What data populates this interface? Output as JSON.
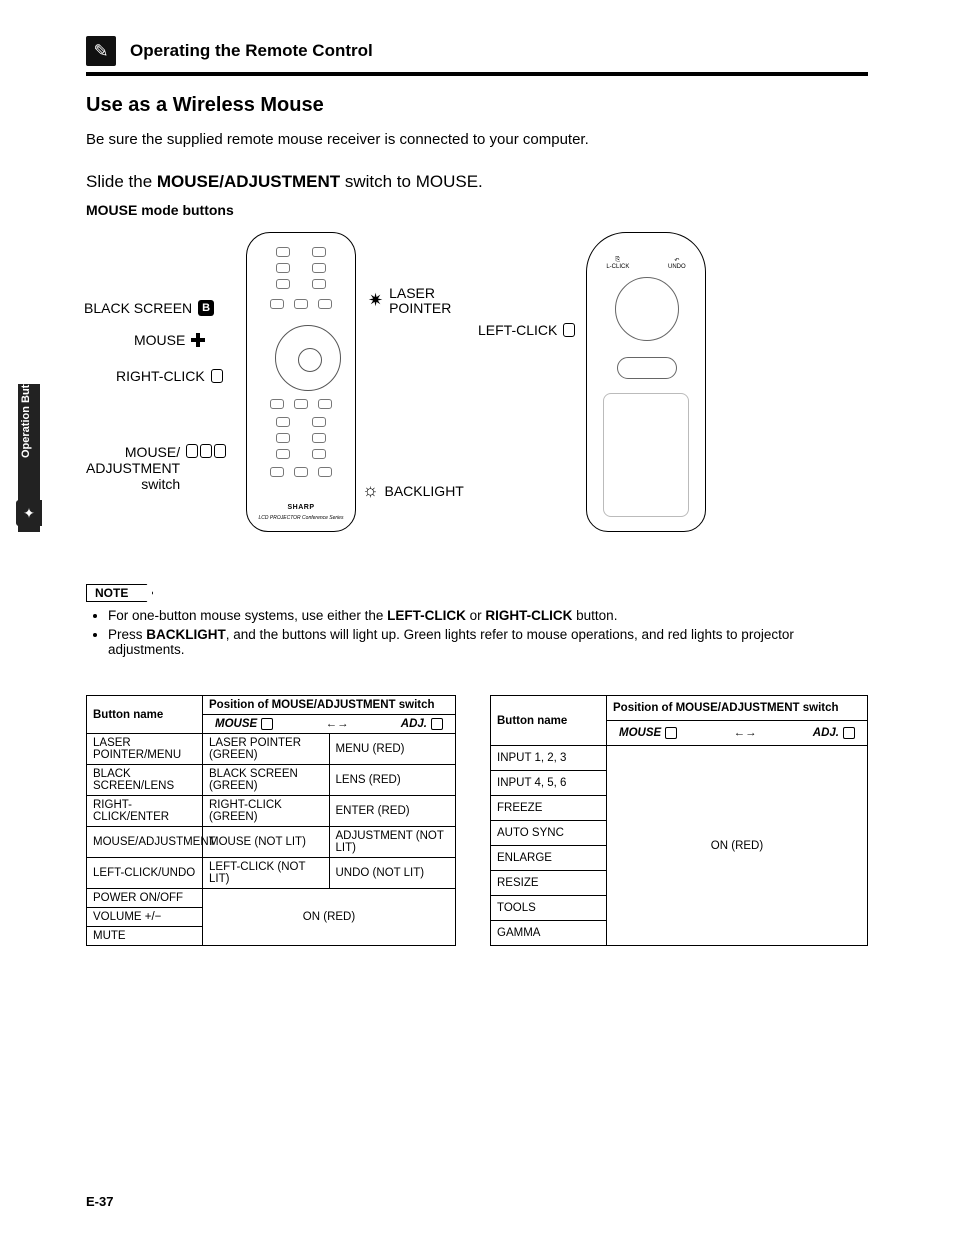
{
  "header": {
    "title": "Operating the Remote Control",
    "sidetab": "Operation Buttons"
  },
  "section": {
    "heading": "Use as a Wireless Mouse",
    "intro": "Be sure the supplied remote mouse receiver is connected to your computer.",
    "slide_pre": "Slide the ",
    "slide_bold": "MOUSE/ADJUSTMENT",
    "slide_post": " switch to MOUSE.",
    "modebtns": "MOUSE mode buttons"
  },
  "callouts": {
    "black_screen": "BLACK SCREEN",
    "mouse": "MOUSE",
    "right_click": "RIGHT-CLICK",
    "mouse_adj_switch_l1": "MOUSE/",
    "mouse_adj_switch_l2": "ADJUSTMENT",
    "mouse_adj_switch_l3": "switch",
    "laser_l1": "LASER",
    "laser_l2": "POINTER",
    "backlight": "BACKLIGHT",
    "left_click": "LEFT-CLICK"
  },
  "remote": {
    "brand": "SHARP",
    "sub": "LCD PROJECTOR  Conference Series",
    "side_lclick": "L-CLICK",
    "side_undo": "UNDO"
  },
  "note": {
    "label": "NOTE",
    "items": [
      {
        "pre": "For one-button mouse systems, use either the ",
        "b1": "LEFT-CLICK",
        "mid": " or ",
        "b2": "RIGHT-CLICK",
        "post": " button."
      },
      {
        "pre": "Press ",
        "b1": "BACKLIGHT",
        "post": ", and the buttons will light up. Green lights refer to mouse operations, and red lights to projector adjustments."
      }
    ]
  },
  "table_common": {
    "col_button": "Button name",
    "col_position": "Position of MOUSE/ADJUSTMENT switch",
    "mode_mouse": "MOUSE",
    "mode_adj": "ADJ.",
    "arrow": "←→"
  },
  "table1": {
    "rows": [
      {
        "name": "LASER POINTER/MENU",
        "mouse": "LASER POINTER (GREEN)",
        "adj": "MENU (RED)"
      },
      {
        "name": "BLACK SCREEN/LENS",
        "mouse": "BLACK SCREEN (GREEN)",
        "adj": "LENS (RED)"
      },
      {
        "name": "RIGHT-CLICK/ENTER",
        "mouse": "RIGHT-CLICK (GREEN)",
        "adj": "ENTER (RED)"
      },
      {
        "name": "MOUSE/ADJUSTMENT",
        "mouse": "MOUSE (NOT LIT)",
        "adj": "ADJUSTMENT (NOT LIT)"
      },
      {
        "name": "LEFT-CLICK/UNDO",
        "mouse": "LEFT-CLICK (NOT LIT)",
        "adj": "UNDO (NOT LIT)"
      }
    ],
    "merged_names": [
      "POWER ON/OFF",
      "VOLUME +/−",
      "MUTE"
    ],
    "merged_value": "ON (RED)"
  },
  "table2": {
    "names": [
      "INPUT 1, 2, 3",
      "INPUT 4, 5, 6",
      "FREEZE",
      "AUTO SYNC",
      "ENLARGE",
      "RESIZE",
      "TOOLS",
      "GAMMA"
    ],
    "merged_value": "ON (RED)"
  },
  "page_number": "E-37"
}
